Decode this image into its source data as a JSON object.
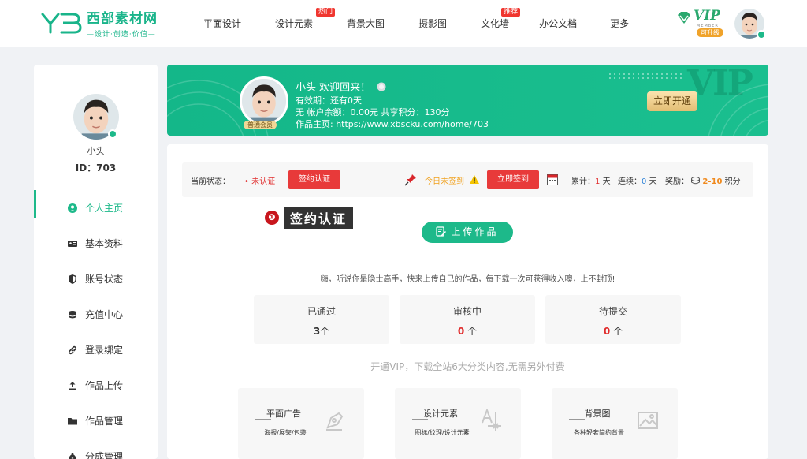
{
  "logo": {
    "mark": "YB",
    "title": "西部素材网",
    "tagline": "—设计·创造·价值—"
  },
  "nav": [
    {
      "label": "平面设计",
      "badge": ""
    },
    {
      "label": "设计元素",
      "badge": "热门"
    },
    {
      "label": "背景大图",
      "badge": ""
    },
    {
      "label": "摄影图",
      "badge": ""
    },
    {
      "label": "文化墙",
      "badge": "推荐"
    },
    {
      "label": "办公文档",
      "badge": ""
    },
    {
      "label": "更多",
      "badge": ""
    }
  ],
  "vip_top": {
    "word": "VIP",
    "member": "MEMBER",
    "upgrade": "可升级"
  },
  "sidebar": {
    "name": "小头",
    "id_text": "ID：703",
    "menu": [
      {
        "label": "个人主页",
        "icon": "user-circle-icon"
      },
      {
        "label": "基本资料",
        "icon": "id-card-icon"
      },
      {
        "label": "账号状态",
        "icon": "shield-icon"
      },
      {
        "label": "充值中心",
        "icon": "coins-icon"
      },
      {
        "label": "登录绑定",
        "icon": "link-icon"
      },
      {
        "label": "作品上传",
        "icon": "upload-icon"
      },
      {
        "label": "作品管理",
        "icon": "folder-icon"
      },
      {
        "label": "分成管理",
        "icon": "money-bag-icon"
      }
    ]
  },
  "banner": {
    "title": "小头 欢迎回来！",
    "validity": "有效期：还有0天",
    "balance": "无  帐户余额：0.00元    共享积分：130分",
    "homepage": "作品主页: https://www.xbscku.com/home/703",
    "level": "普通会员",
    "vip_text": "VIP",
    "open_button": "立即开通"
  },
  "status": {
    "label": "当前状态：",
    "value": "• 未认证",
    "verify_button": "签约认证",
    "sign_status": "今日未签到",
    "sign_button": "立即签到",
    "cumulative_label": "累计：",
    "cumulative_value": "1",
    "cumulative_unit": "天",
    "streak_label": "连续：",
    "streak_value": "0",
    "streak_unit": "天",
    "reward_label": "奖励：",
    "reward_value": "2-10",
    "reward_unit": "积分"
  },
  "annotation": {
    "number": "❶",
    "text": "签约认证"
  },
  "upload_button": "上传作品",
  "hint": "嗨，听说你是隐士高手，快来上传自己的作品，每下载一次可获得收入噢，上不封顶!",
  "stats": [
    {
      "label": "已通过",
      "value": "3",
      "unit": "个",
      "highlight": false
    },
    {
      "label": "审核中",
      "value": "0",
      "unit": "个",
      "highlight": true
    },
    {
      "label": "待提交",
      "value": "0",
      "unit": "个",
      "highlight": true
    }
  ],
  "promo": "开通VIP，下载全站6大分类内容,无需另外付费",
  "categories": [
    {
      "title": "平面广告",
      "sub": "海报/展架/包装",
      "icon": "pen-icon"
    },
    {
      "title": "设计元素",
      "sub": "图标/纹理/设计元素",
      "icon": "text-tool-icon"
    },
    {
      "title": "背景图",
      "sub": "各种轻奢简约背景",
      "icon": "image-icon"
    }
  ],
  "colors": {
    "brand": "#1db98a",
    "red": "#e83a3a",
    "gold": "#e3bd73"
  }
}
